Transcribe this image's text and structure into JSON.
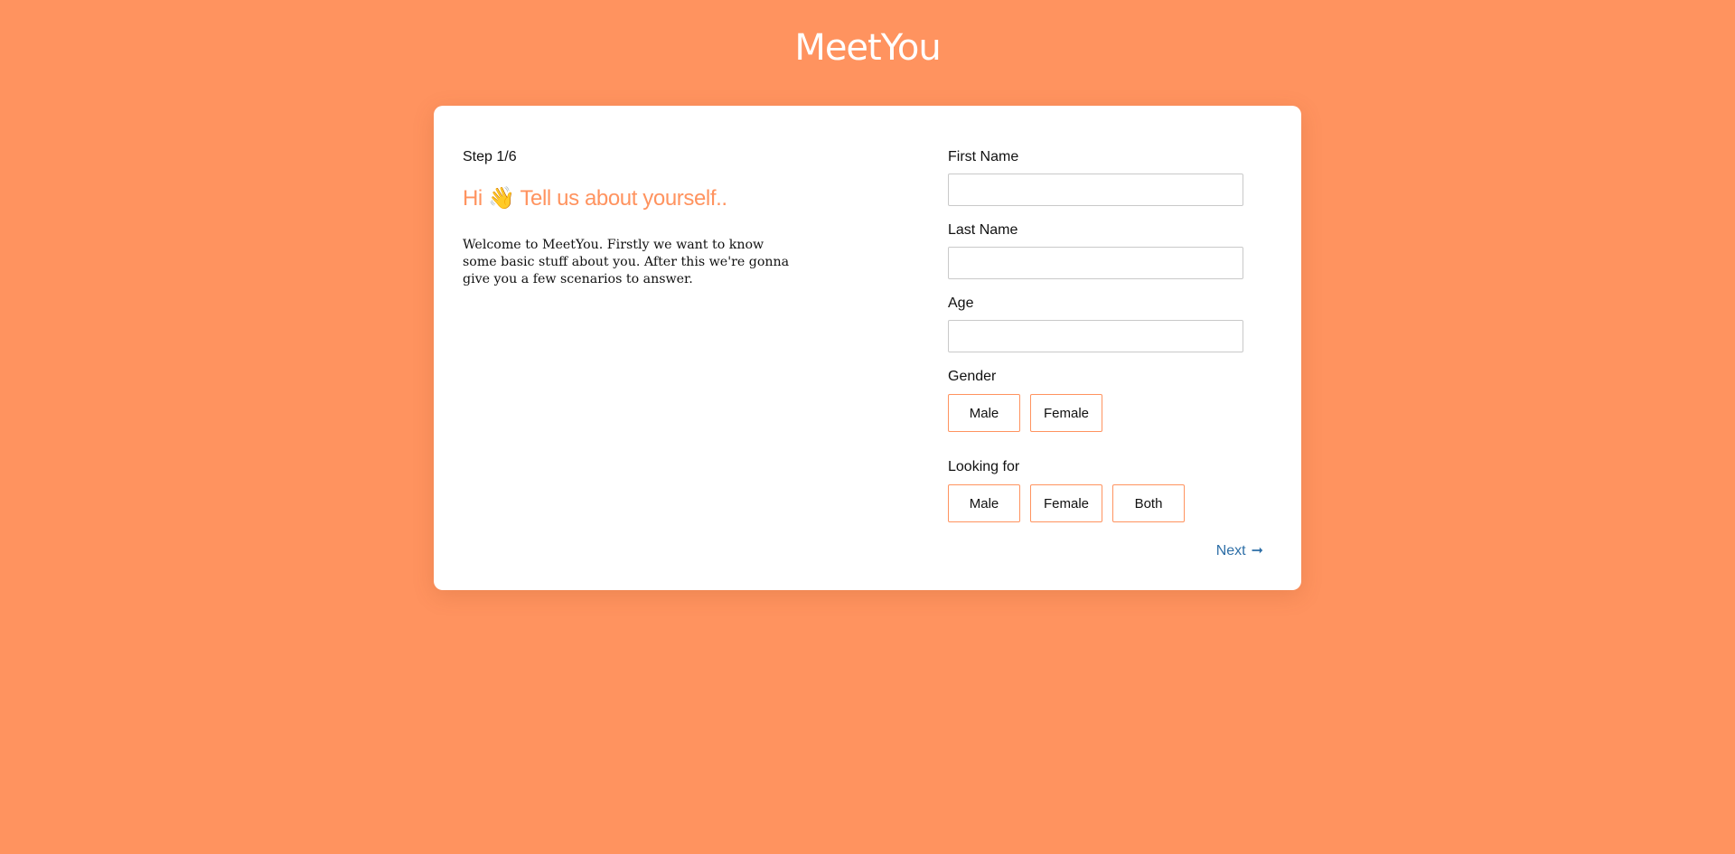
{
  "app": {
    "logo_text": "MeetYou"
  },
  "intro": {
    "step": "Step 1/6",
    "heading": "Hi 👋 Tell us about yourself..",
    "description": "Welcome to MeetYou. Firstly we want to know some basic stuff about you. After this we're gonna give you a few scenarios to answer."
  },
  "form": {
    "first_name": {
      "label": "First Name",
      "value": "",
      "placeholder": ""
    },
    "last_name": {
      "label": "Last Name",
      "value": "",
      "placeholder": ""
    },
    "age": {
      "label": "Age",
      "value": "",
      "placeholder": ""
    },
    "gender": {
      "label": "Gender",
      "options": [
        "Male",
        "Female"
      ]
    },
    "looking_for": {
      "label": "Looking for",
      "options": [
        "Male",
        "Female",
        "Both"
      ]
    }
  },
  "navigation": {
    "next_label": "Next",
    "next_icon": "arrow-right-icon"
  },
  "colors": {
    "background": "#ff935f",
    "accent": "#ff935f",
    "link": "#2e6fa7"
  }
}
